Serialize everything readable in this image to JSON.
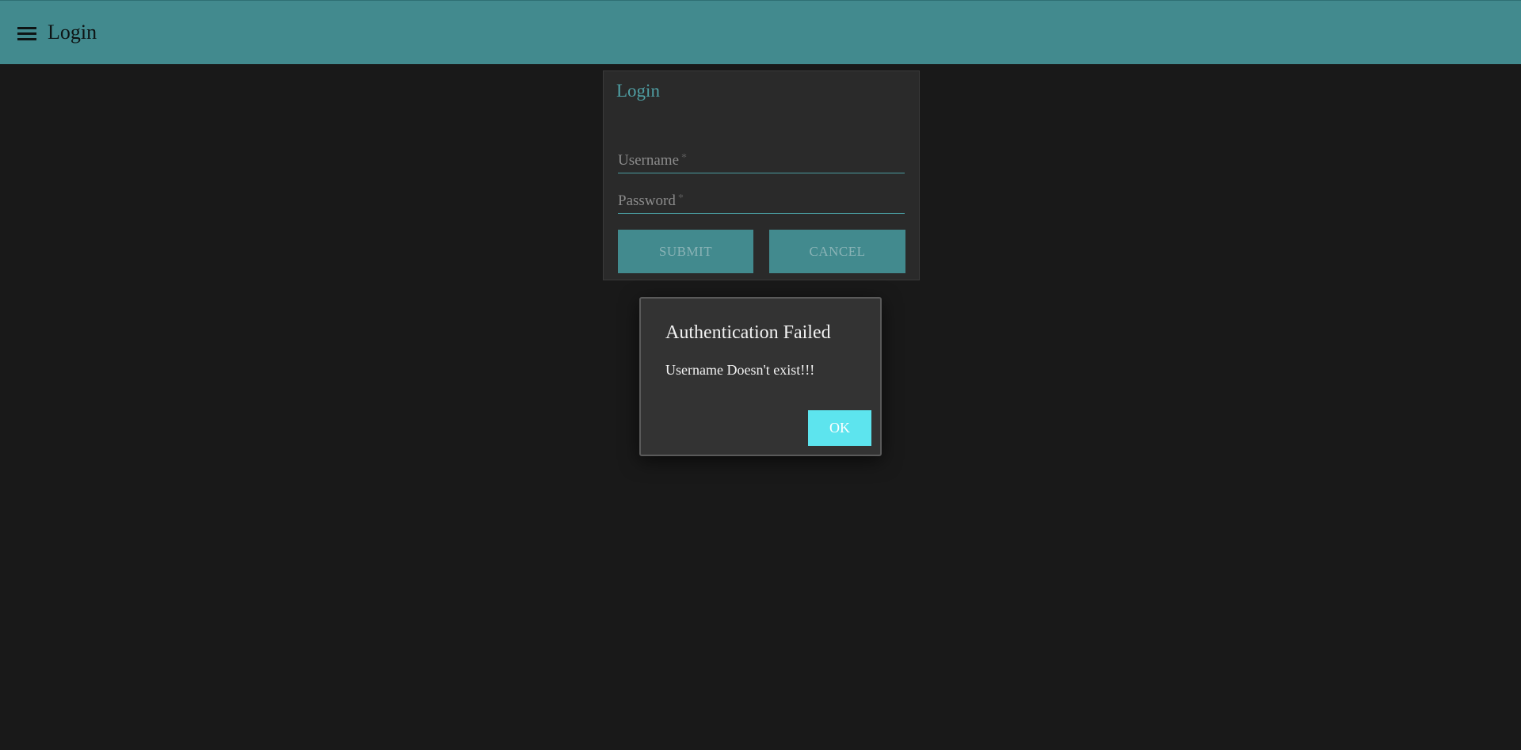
{
  "toolbar": {
    "menu_icon": "menu-icon",
    "title": "Login"
  },
  "login_card": {
    "title": "Login",
    "username": {
      "label": "Username",
      "required_mark": "*",
      "value": ""
    },
    "password": {
      "label": "Password",
      "required_mark": "*",
      "value": ""
    },
    "submit_label": "SUBMIT",
    "cancel_label": "CANCEL"
  },
  "dialog": {
    "title": "Authentication Failed",
    "message": "Username Doesn't exist!!!",
    "ok_label": "OK"
  },
  "colors": {
    "toolbar_bg": "#428a8e",
    "page_bg": "#191919",
    "accent": "#4f9ea3",
    "ok_button": "#5de4ee"
  }
}
